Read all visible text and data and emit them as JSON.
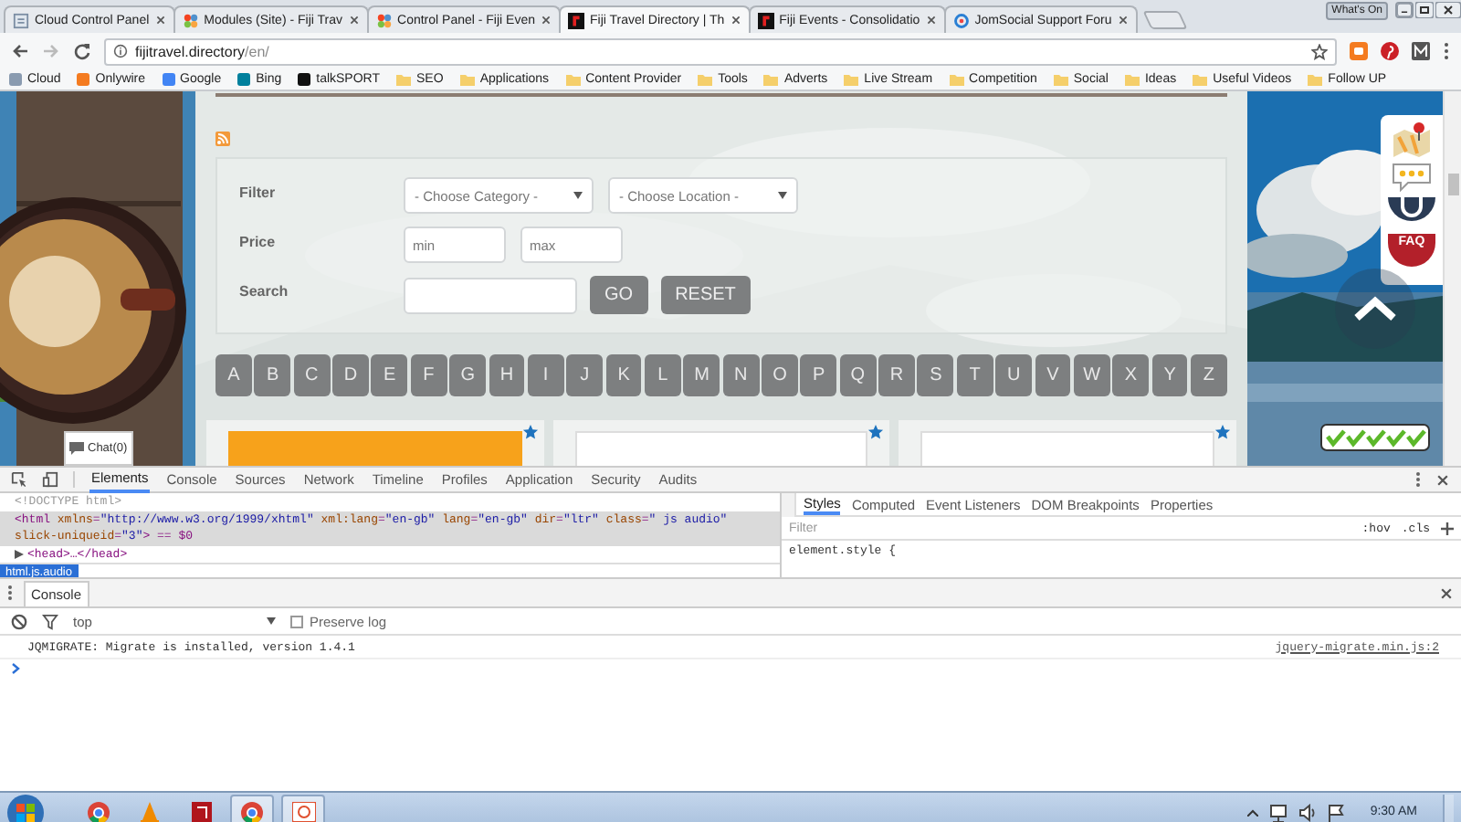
{
  "browser": {
    "tabs": [
      {
        "title": "Cloud Control Panel",
        "kind": "page",
        "selected": false
      },
      {
        "title": "Modules (Site) - Fiji Trav",
        "kind": "pinwheel",
        "selected": false
      },
      {
        "title": "Control Panel - Fiji Even",
        "kind": "pinwheel",
        "selected": false
      },
      {
        "title": "Fiji Travel Directory | Th",
        "kind": "logo",
        "selected": true
      },
      {
        "title": "Fiji Events - Consolidatio",
        "kind": "logo",
        "selected": false
      },
      {
        "title": "JomSocial Support Foru",
        "kind": "ring",
        "selected": false
      }
    ],
    "profile_label": "What's On",
    "url": {
      "host": "fijitravel.directory",
      "path": "/en/"
    },
    "bookmarks": [
      {
        "label": "Cloud",
        "kind": "site",
        "color": "#8a9bb0"
      },
      {
        "label": "Onlywire",
        "kind": "site",
        "color": "#f47b20"
      },
      {
        "label": "Google",
        "kind": "site",
        "color": "#4285f4"
      },
      {
        "label": "Bing",
        "kind": "site",
        "color": "#00809d"
      },
      {
        "label": "talkSPORT",
        "kind": "site",
        "color": "#111111"
      },
      {
        "label": "SEO",
        "kind": "folder"
      },
      {
        "label": "Applications",
        "kind": "folder"
      },
      {
        "label": "Content Provider",
        "kind": "folder"
      },
      {
        "label": "Tools",
        "kind": "folder"
      },
      {
        "label": "Adverts",
        "kind": "folder"
      },
      {
        "label": "Live Stream",
        "kind": "folder"
      },
      {
        "label": "Competition",
        "kind": "folder"
      },
      {
        "label": "Social",
        "kind": "folder"
      },
      {
        "label": "Ideas",
        "kind": "folder"
      },
      {
        "label": "Useful Videos",
        "kind": "folder"
      },
      {
        "label": "Follow UP",
        "kind": "folder"
      }
    ]
  },
  "page": {
    "filter_label": "Filter",
    "category": "- Choose Category -",
    "location": "- Choose Location -",
    "price_label": "Price",
    "price_min": {
      "placeholder": "min"
    },
    "price_max": {
      "placeholder": "max"
    },
    "search_label": "Search",
    "buttons": [
      "GO",
      "RESET"
    ],
    "letters": [
      "A",
      "B",
      "C",
      "D",
      "E",
      "F",
      "G",
      "H",
      "I",
      "J",
      "K",
      "L",
      "M",
      "N",
      "O",
      "P",
      "Q",
      "R",
      "S",
      "T",
      "U",
      "V",
      "W",
      "X",
      "Y",
      "Z"
    ],
    "cards": [
      {
        "kind": "banner"
      },
      {
        "kind": "empty"
      },
      {
        "kind": "empty"
      }
    ],
    "chat": "Chat(0)",
    "faq": "FAQ"
  },
  "devtools": {
    "tabs": [
      {
        "label": "Elements",
        "selected": true
      },
      {
        "label": "Console",
        "selected": false
      },
      {
        "label": "Sources",
        "selected": false
      },
      {
        "label": "Network",
        "selected": false
      },
      {
        "label": "Timeline",
        "selected": false
      },
      {
        "label": "Profiles",
        "selected": false
      },
      {
        "label": "Application",
        "selected": false
      },
      {
        "label": "Security",
        "selected": false
      },
      {
        "label": "Audits",
        "selected": false
      }
    ],
    "nodes": [
      {
        "text": "<!DOCTYPE html>",
        "kind": "doctype",
        "selected": false
      },
      {
        "text": "<html xmlns=\"http://www.w3.org/1999/xhtml\" xml:lang=\"en-gb\" lang=\"en-gb\" dir=\"ltr\" class=\" js audio\"",
        "kind": "element",
        "selected": true
      },
      {
        "text": "slick-uniqueid=\"3\"> == $0",
        "kind": "continuation",
        "selected": true
      },
      {
        "text": "<head>…</head>",
        "kind": "collapsed",
        "selected": false
      }
    ],
    "breadcrumb": "html.js.audio",
    "style_tabs": [
      {
        "label": "Styles",
        "selected": true
      },
      {
        "label": "Computed",
        "selected": false
      },
      {
        "label": "Event Listeners",
        "selected": false
      },
      {
        "label": "DOM Breakpoints",
        "selected": false
      },
      {
        "label": "Properties",
        "selected": false
      }
    ],
    "styles_filter": {
      "placeholder": "Filter"
    },
    "state_toggles": [
      ":hov",
      ".cls"
    ],
    "style_rule": "element.style {",
    "drawer_tab": "Console",
    "context": "top",
    "preserve_log": {
      "label": "Preserve log",
      "checked": false
    },
    "messages": [
      {
        "text": "JQMIGRATE: Migrate is installed, version 1.4.1",
        "source": "jquery-migrate.min.js:2"
      }
    ]
  },
  "taskbar": {
    "apps": [
      {
        "kind": "browser",
        "open": false
      },
      {
        "kind": "cone",
        "open": false
      },
      {
        "kind": "document",
        "open": false
      },
      {
        "kind": "browser",
        "open": true
      },
      {
        "kind": "slides",
        "open": true
      }
    ],
    "clock": "9:30 AM"
  }
}
